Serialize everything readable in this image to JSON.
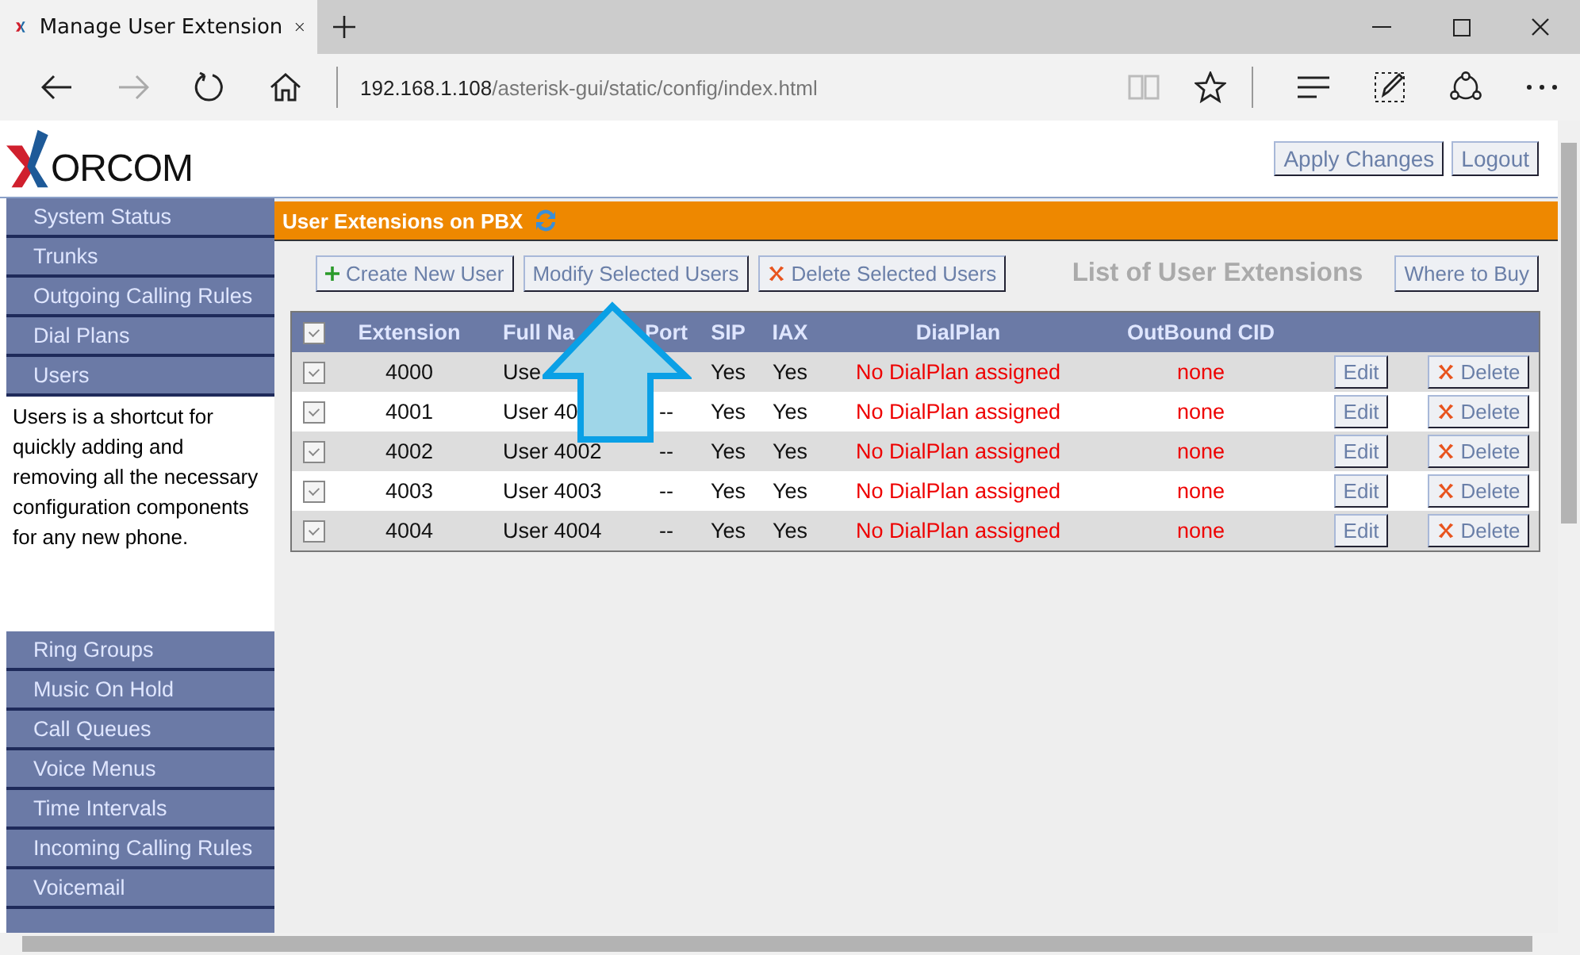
{
  "browser": {
    "tab_title": "Manage User Extension",
    "url_host": "192.168.1.108",
    "url_path": "/asterisk-gui/static/config/index.html"
  },
  "header": {
    "logo_text": "ORCOM",
    "buttons": [
      "Apply Changes",
      "Logout"
    ]
  },
  "sidebar": {
    "items": [
      {
        "label": "System Status"
      },
      {
        "label": "Trunks"
      },
      {
        "label": "Outgoing Calling Rules"
      },
      {
        "label": "Dial Plans"
      },
      {
        "label": "Users",
        "description": "Users is a shortcut for quickly adding and removing all the necessary configuration components for any new phone."
      },
      {
        "label": "Ring Groups"
      },
      {
        "label": "Music On Hold"
      },
      {
        "label": "Call Queues"
      },
      {
        "label": "Voice Menus"
      },
      {
        "label": "Time Intervals"
      },
      {
        "label": "Incoming Calling Rules"
      },
      {
        "label": "Voicemail"
      }
    ]
  },
  "panel": {
    "title": "User Extensions on PBX",
    "actions": [
      {
        "kind": "create",
        "label": "Create New User"
      },
      {
        "kind": "modify",
        "label": "Modify Selected Users"
      },
      {
        "kind": "delete",
        "label": "Delete Selected Users"
      }
    ],
    "list_title": "List of User Extensions",
    "where_to_buy": "Where to Buy"
  },
  "table": {
    "select_all_checked": true,
    "columns": [
      "Extension",
      "Full Na",
      "Port",
      "SIP",
      "IAX",
      "DialPlan",
      "OutBound CID"
    ],
    "rows": [
      {
        "checked": true,
        "extension": "4000",
        "full_name": "Use",
        "port": "",
        "sip": "Yes",
        "iax": "Yes",
        "dialplan": "No DialPlan assigned",
        "outbound_cid": "none",
        "edit": "Edit",
        "delete": "Delete"
      },
      {
        "checked": true,
        "extension": "4001",
        "full_name": "User 40",
        "port": "--",
        "sip": "Yes",
        "iax": "Yes",
        "dialplan": "No DialPlan assigned",
        "outbound_cid": "none",
        "edit": "Edit",
        "delete": "Delete"
      },
      {
        "checked": true,
        "extension": "4002",
        "full_name": "User 4002",
        "port": "--",
        "sip": "Yes",
        "iax": "Yes",
        "dialplan": "No DialPlan assigned",
        "outbound_cid": "none",
        "edit": "Edit",
        "delete": "Delete"
      },
      {
        "checked": true,
        "extension": "4003",
        "full_name": "User 4003",
        "port": "--",
        "sip": "Yes",
        "iax": "Yes",
        "dialplan": "No DialPlan assigned",
        "outbound_cid": "none",
        "edit": "Edit",
        "delete": "Delete"
      },
      {
        "checked": true,
        "extension": "4004",
        "full_name": "User 4004",
        "port": "--",
        "sip": "Yes",
        "iax": "Yes",
        "dialplan": "No DialPlan assigned",
        "outbound_cid": "none",
        "edit": "Edit",
        "delete": "Delete"
      }
    ]
  }
}
